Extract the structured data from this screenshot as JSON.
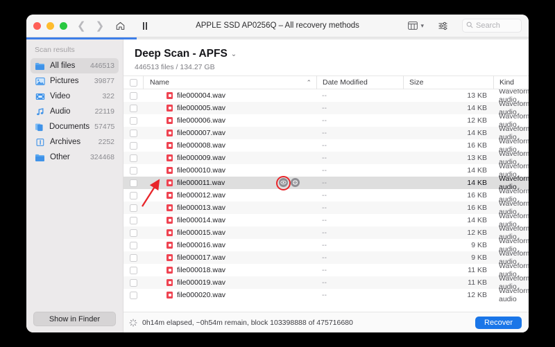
{
  "window": {
    "title": "APPLE SSD AP0256Q – All recovery methods",
    "traffic_lights": [
      "close",
      "minimize",
      "zoom"
    ],
    "progress_percent": 22
  },
  "toolbar": {
    "back_icon": "chevron-left-icon",
    "forward_icon": "chevron-right-icon",
    "home_icon": "home-icon",
    "pause_icon": "pause-icon",
    "view_icon": "column-view-icon",
    "view_dropdown_icon": "chevron-down-icon",
    "filter_icon": "sliders-icon",
    "search_icon": "search-icon",
    "search_placeholder": "Search",
    "search_value": ""
  },
  "sidebar": {
    "section_title": "Scan results",
    "items": [
      {
        "label": "All files",
        "count": "446513",
        "icon": "folder-icon",
        "active": true
      },
      {
        "label": "Pictures",
        "count": "39877",
        "icon": "photo-icon",
        "active": false
      },
      {
        "label": "Video",
        "count": "322",
        "icon": "film-icon",
        "active": false
      },
      {
        "label": "Audio",
        "count": "22119",
        "icon": "music-note-icon",
        "active": false
      },
      {
        "label": "Documents",
        "count": "57475",
        "icon": "documents-icon",
        "active": false
      },
      {
        "label": "Archives",
        "count": "2252",
        "icon": "archive-icon",
        "active": false
      },
      {
        "label": "Other",
        "count": "324468",
        "icon": "folder-icon",
        "active": false
      }
    ],
    "show_in_finder_label": "Show in Finder"
  },
  "main": {
    "scan_title": "Deep Scan - APFS",
    "scan_title_caret": "⌄",
    "scan_subtitle": "446513 files / 134.27 GB",
    "columns": [
      {
        "key": "name",
        "label": "Name",
        "sorted": "asc",
        "sort_glyph": "⌃"
      },
      {
        "key": "date",
        "label": "Date Modified"
      },
      {
        "key": "size",
        "label": "Size"
      },
      {
        "key": "kind",
        "label": "Kind"
      }
    ],
    "rows": [
      {
        "name": "file000004.wav",
        "date": "--",
        "size": "13 KB",
        "kind": "Waveform audio",
        "selected": false
      },
      {
        "name": "file000005.wav",
        "date": "--",
        "size": "14 KB",
        "kind": "Waveform audio",
        "selected": false
      },
      {
        "name": "file000006.wav",
        "date": "--",
        "size": "12 KB",
        "kind": "Waveform audio",
        "selected": false
      },
      {
        "name": "file000007.wav",
        "date": "--",
        "size": "14 KB",
        "kind": "Waveform audio",
        "selected": false
      },
      {
        "name": "file000008.wav",
        "date": "--",
        "size": "16 KB",
        "kind": "Waveform audio",
        "selected": false
      },
      {
        "name": "file000009.wav",
        "date": "--",
        "size": "13 KB",
        "kind": "Waveform audio",
        "selected": false
      },
      {
        "name": "file000010.wav",
        "date": "--",
        "size": "14 KB",
        "kind": "Waveform audio",
        "selected": false
      },
      {
        "name": "file000011.wav",
        "date": "--",
        "size": "14 KB",
        "kind": "Waveform audio",
        "selected": true
      },
      {
        "name": "file000012.wav",
        "date": "--",
        "size": "16 KB",
        "kind": "Waveform audio",
        "selected": false
      },
      {
        "name": "file000013.wav",
        "date": "--",
        "size": "16 KB",
        "kind": "Waveform audio",
        "selected": false
      },
      {
        "name": "file000014.wav",
        "date": "--",
        "size": "14 KB",
        "kind": "Waveform audio",
        "selected": false
      },
      {
        "name": "file000015.wav",
        "date": "--",
        "size": "12 KB",
        "kind": "Waveform audio",
        "selected": false
      },
      {
        "name": "file000016.wav",
        "date": "--",
        "size": "9 KB",
        "kind": "Waveform audio",
        "selected": false
      },
      {
        "name": "file000017.wav",
        "date": "--",
        "size": "9 KB",
        "kind": "Waveform audio",
        "selected": false
      },
      {
        "name": "file000018.wav",
        "date": "--",
        "size": "11 KB",
        "kind": "Waveform audio",
        "selected": false
      },
      {
        "name": "file000019.wav",
        "date": "--",
        "size": "11 KB",
        "kind": "Waveform audio",
        "selected": false
      },
      {
        "name": "file000020.wav",
        "date": "--",
        "size": "12 KB",
        "kind": "Waveform audio",
        "selected": false
      }
    ],
    "row_actions": {
      "preview_icon": "eye-icon",
      "info_icon": "gear-icon",
      "highlight_color": "#e8252a"
    }
  },
  "statusbar": {
    "spinner_icon": "spinner-icon",
    "text": "0h14m elapsed, ~0h54m remain, block 103398888 of 475716680",
    "recover_label": "Recover"
  },
  "colors": {
    "accent_blue": "#1a76e8",
    "progress_blue": "#3d7ee8",
    "annotation_red": "#e8252a",
    "sidebar_bg": "#eceaeb",
    "selected_row": "#dedede"
  }
}
